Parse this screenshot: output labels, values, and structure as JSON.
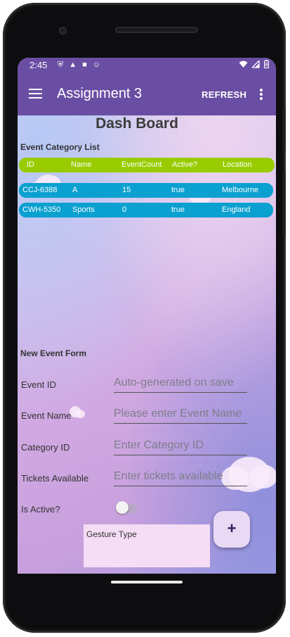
{
  "status_bar": {
    "time": "2:45",
    "left_icons": [
      "shield-icon",
      "navigation-icon",
      "sd-card-icon",
      "face-icon"
    ],
    "right_icons": [
      "wifi-icon",
      "signal-icon",
      "battery-icon"
    ]
  },
  "app_bar": {
    "title": "Assignment 3",
    "refresh_label": "REFRESH",
    "menu_icon": "hamburger-menu-icon",
    "overflow_icon": "more-vert-icon",
    "color": "#6a4ea3"
  },
  "dashboard": {
    "title": "Dash Board",
    "category_section_title": "Event Category List",
    "table": {
      "columns": [
        "ID",
        "Name",
        "EventCount",
        "Active?",
        "Location"
      ],
      "rows": [
        [
          "CCJ-6388",
          "A",
          "15",
          "true",
          "Melbourne"
        ],
        [
          "CWH-5350",
          "Sports",
          "0",
          "true",
          "England"
        ]
      ],
      "header_color": "#99cc00",
      "row_color": "#0aa0d0"
    }
  },
  "form": {
    "title": "New Event Form",
    "fields": [
      {
        "label": "Event ID",
        "placeholder": "Auto-generated on save"
      },
      {
        "label": "Event Name",
        "placeholder": "Please enter Event Name"
      },
      {
        "label": "Category ID",
        "placeholder": "Enter Category ID"
      },
      {
        "label": "Tickets Available",
        "placeholder": "Enter tickets available"
      }
    ],
    "active_label": "Is Active?",
    "active_value": false
  },
  "gesture": {
    "label": "Gesture Type"
  },
  "fab": {
    "symbol": "+",
    "icon": "add-icon"
  }
}
